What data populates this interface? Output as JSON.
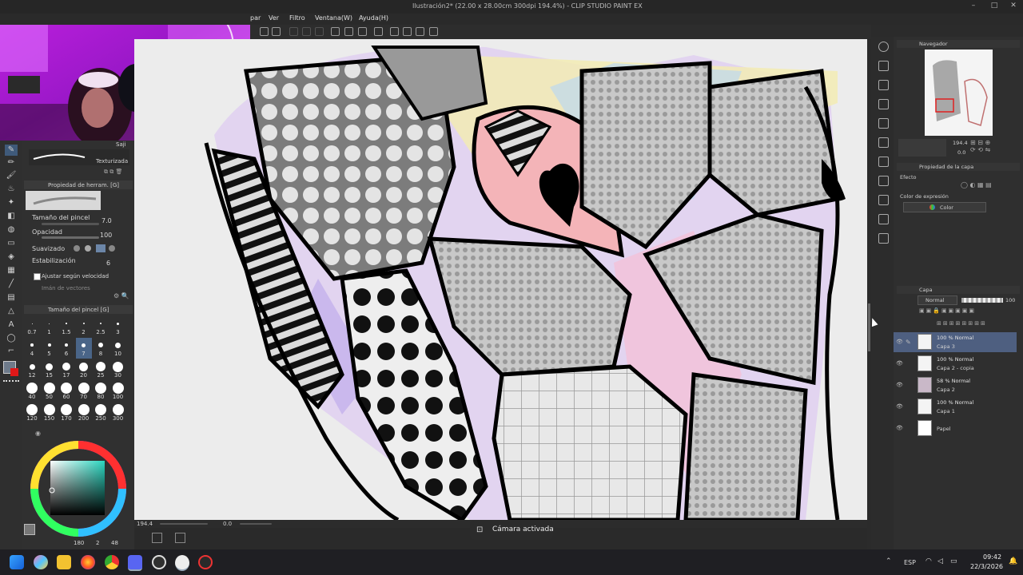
{
  "window": {
    "title": "Ilustración2* (22.00 x 28.00cm 300dpi 194.4%) - CLIP STUDIO PAINT EX"
  },
  "menu": [
    {
      "label": "par"
    },
    {
      "label": "Ver"
    },
    {
      "label": "Filtro"
    },
    {
      "label": "Ventana(W)"
    },
    {
      "label": "Ayuda(H)"
    }
  ],
  "sub_tool": {
    "brush_name": "Saji",
    "brush_preset": "Texturizada"
  },
  "tool_property": {
    "title": "Propiedad de herram. [G]",
    "brush_size_label": "Tamaño del pincel",
    "brush_size_value": "7.0",
    "opacity_label": "Opacidad",
    "opacity_value": "100",
    "smoothing_label": "Suavizado",
    "stabilization_label": "Estabilización",
    "stabilization_value": "6",
    "adjust_speed_label": "Ajustar según velocidad",
    "vector_magnet_label": "Imán de vectores"
  },
  "brush_size_panel": {
    "title": "Tamaño del pincel [G]",
    "sizes": [
      "0.7",
      "1",
      "1.5",
      "2",
      "2.5",
      "3",
      "4",
      "5",
      "6",
      "7",
      "8",
      "10",
      "12",
      "15",
      "17",
      "20",
      "25",
      "30",
      "40",
      "50",
      "60",
      "70",
      "80",
      "100",
      "120",
      "150",
      "170",
      "200",
      "250",
      "300"
    ],
    "selected": "7"
  },
  "color": {
    "main": "#2f6b5f",
    "sub": "#e01818",
    "status_1": "180",
    "status_2": "2",
    "status_3": "48"
  },
  "canvas": {
    "zoom": "194.4",
    "rotation": "0.0"
  },
  "navigator": {
    "title": "Navegador",
    "zoom": "194.4",
    "rotation": "0.0"
  },
  "layer_property": {
    "title": "Propiedad de la capa",
    "effect_label": "Efecto",
    "expression_color_label": "Color de expresión",
    "expression_color_value": "Color"
  },
  "layers": {
    "title": "Capa",
    "blend_mode": "Normal",
    "opacity": "100",
    "items": [
      {
        "mode": "100 % Normal",
        "name": "Capa 3",
        "selected": true
      },
      {
        "mode": "100 % Normal",
        "name": "Capa 2 - copia",
        "selected": false
      },
      {
        "mode": "58 % Normal",
        "name": "Capa 2",
        "selected": false
      },
      {
        "mode": "100 % Normal",
        "name": "Capa 1",
        "selected": false
      },
      {
        "mode": "",
        "name": "Papel",
        "selected": false
      }
    ]
  },
  "toast": {
    "text": "Cámara activada"
  },
  "taskbar": {
    "language": "ESP",
    "time": "09:42",
    "date": "22/3/2026",
    "apps": [
      "windows-start",
      "copilot",
      "file-explorer",
      "firefox",
      "chrome",
      "discord",
      "obs",
      "clip-studio",
      "app-red"
    ]
  }
}
